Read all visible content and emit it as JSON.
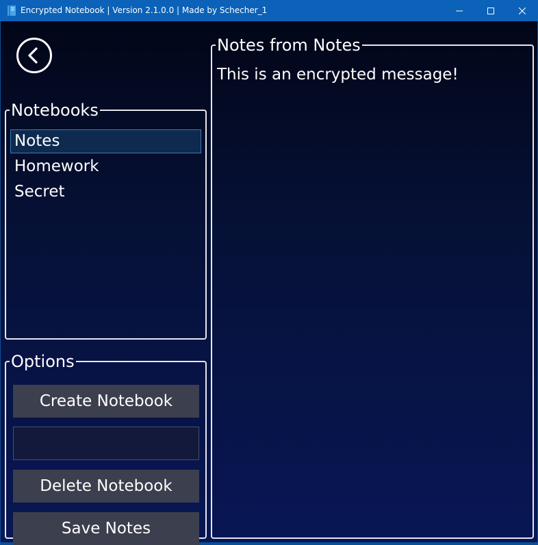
{
  "window": {
    "title": "Encrypted Notebook | Version 2.1.0.0 | Made by Schecher_1",
    "icon": "notebook-icon",
    "controls": [
      "minimize",
      "maximize",
      "close"
    ]
  },
  "back_button": {
    "icon": "back-arrow-icon"
  },
  "notebooks": {
    "label": "Notebooks",
    "items": [
      {
        "label": "Notes",
        "selected": true
      },
      {
        "label": "Homework",
        "selected": false
      },
      {
        "label": "Secret",
        "selected": false
      }
    ]
  },
  "options": {
    "label": "Options",
    "create_label": "Create Notebook",
    "name_input_value": "",
    "delete_label": "Delete Notebook",
    "save_label": "Save Notes"
  },
  "notes": {
    "label": "Notes from Notes",
    "content": "This is an encrypted message!"
  },
  "colors": {
    "titlebar": "#0b62b8",
    "background_top": "#020618",
    "background_bottom": "#081655",
    "button": "#3c3f4d",
    "selected_item": "#0e2a4f",
    "border": "#e6e8ef"
  }
}
